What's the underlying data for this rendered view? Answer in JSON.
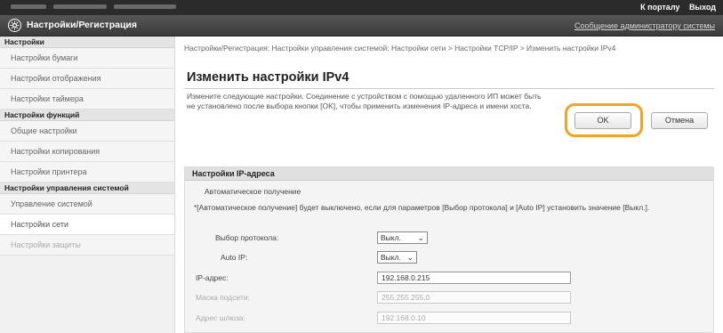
{
  "topbar": {
    "portal_link": "К порталу",
    "logout_link": "Выход"
  },
  "header": {
    "title": "Настройки/Регистрация",
    "message_link": "Сообщение администратору системы"
  },
  "sidebar": {
    "sections": [
      {
        "label": "Настройки",
        "items": [
          "Настройки бумаги",
          "Настройки отображения",
          "Настройки таймера"
        ]
      },
      {
        "label": "Настройки функций",
        "items": [
          "Общие настройки",
          "Настройки копирования",
          "Настройки принтера"
        ]
      },
      {
        "label": "Настройки управления системой",
        "items": [
          "Управление системой",
          "Настройки сети",
          "Настройки защиты"
        ]
      }
    ]
  },
  "main": {
    "breadcrumb": "Настройки/Регистрация: Настройки управления системой: Настройки сети > Настройки TCP/IP > Изменить настройки IPv4",
    "title": "Изменить настройки IPv4",
    "description": "Измените следующие настройки. Соединение с устройством с помощью удаленного ИП может быть не установлено после выбора кнопки [OK], чтобы применить изменения IP-адреса и имени хоста.",
    "ok_label": "OK",
    "cancel_label": "Отмена",
    "panel": {
      "header": "Настройки IP-адреса",
      "auto_header": "Автоматическое получение",
      "note": "*[Автоматическое получение] будет выключено, если для параметров [Выбор протокола] и [Auto IP] установить значение [Выкл.].",
      "protocol_label": "Выбор протокола:",
      "protocol_value": "Выкл.",
      "autoip_label": "Auto IP:",
      "autoip_value": "Выкл.",
      "ip_label": "IP-адрес:",
      "ip_value": "192.168.0.215",
      "mask_label": "Маска подсети:",
      "mask_value": "255.255.255.0",
      "gateway_label": "Адрес шлюза:",
      "gateway_value": "192.168.0.10"
    }
  }
}
